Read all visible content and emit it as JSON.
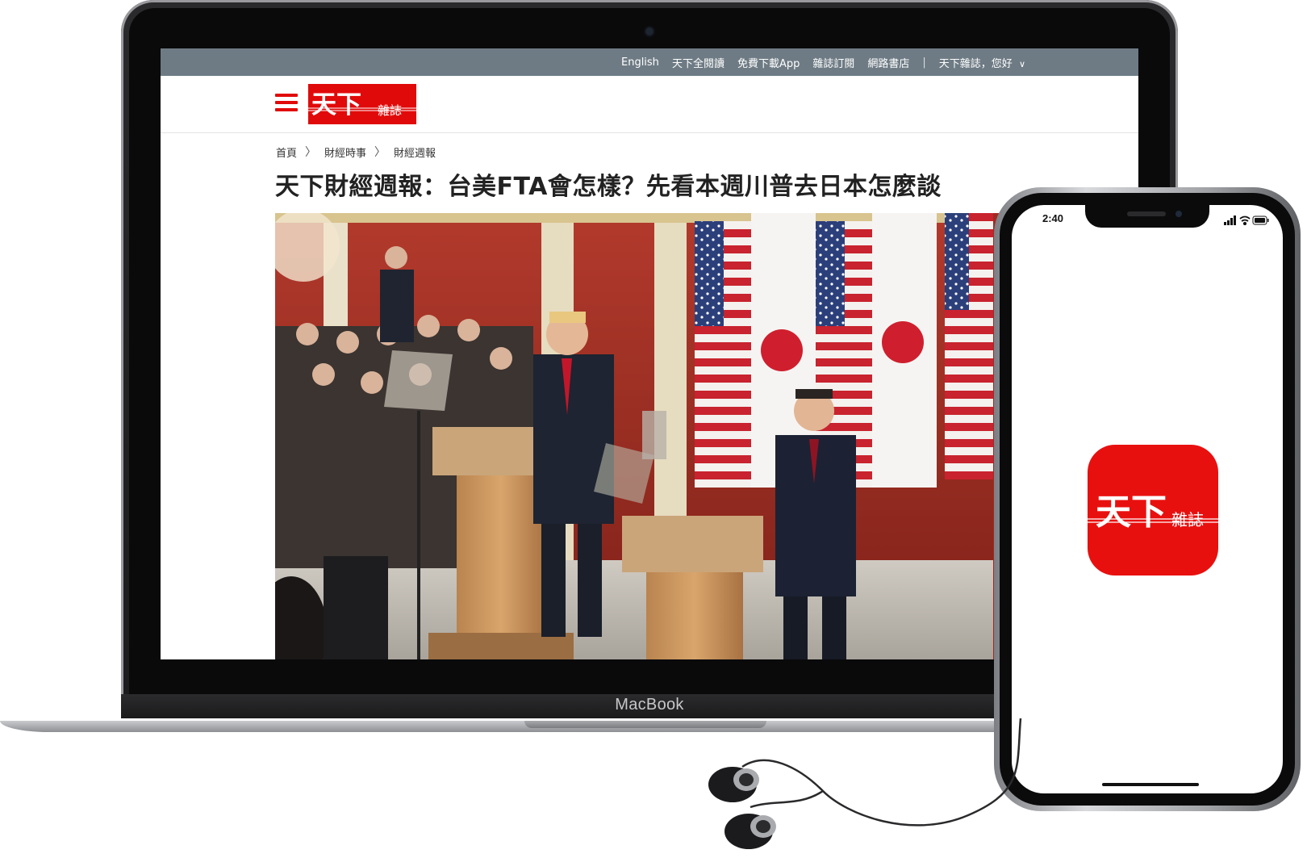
{
  "laptop": {
    "brand": "MacBook"
  },
  "website": {
    "topbar": {
      "links": [
        "English",
        "天下全閱讀",
        "免費下載App",
        "雜誌訂閱",
        "網路書店"
      ],
      "separator": "|",
      "greeting": "天下雜誌，您好",
      "chevron": "∨"
    },
    "logo": {
      "main": "天下",
      "sub": "雜誌"
    },
    "breadcrumb": {
      "items": [
        "首頁",
        "財經時事",
        "財經週報"
      ],
      "arrow": "〉"
    },
    "headline": "天下財經週報：台美FTA會怎樣？先看本週川普去日本怎麼談",
    "colors": {
      "brand_red": "#e10a0a",
      "topbar_gray": "#6e7b84"
    }
  },
  "phone": {
    "status_time": "2:40",
    "app_icon": {
      "main": "天下",
      "sub": "雜誌"
    }
  }
}
